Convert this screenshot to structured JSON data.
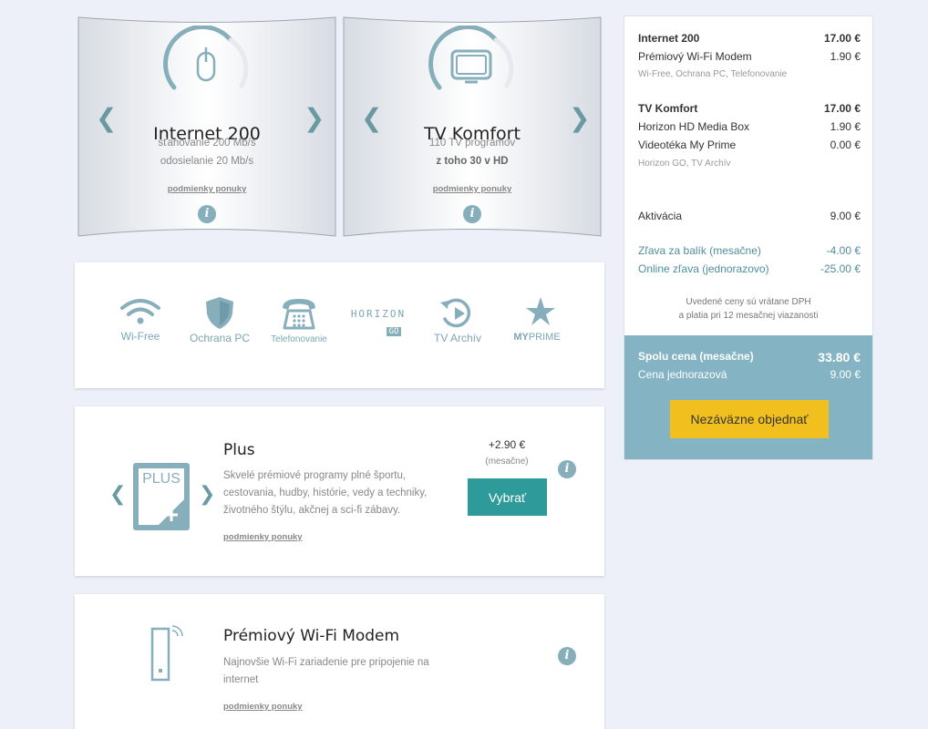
{
  "packages": [
    {
      "title": "Internet 200",
      "line1": "sťahovanie 200 Mb/s",
      "line2": "odosielanie 20 Mb/s",
      "terms": "podmienky ponuky",
      "icon": "mouse-icon"
    },
    {
      "title": "TV Komfort",
      "line1": "110 TV programov",
      "line2": "z toho 30 v HD",
      "terms": "podmienky ponuky",
      "icon": "tv-icon"
    }
  ],
  "glyphs": {
    "prev": "❮",
    "next": "❯",
    "info": "i"
  },
  "features": [
    {
      "label": "Wi-Free",
      "icon": "wifi-icon"
    },
    {
      "label": "Ochrana PC",
      "icon": "shield-icon"
    },
    {
      "label": "Telefonovanie",
      "icon": "phone-icon"
    },
    {
      "label": "HORIZON",
      "label2": "GO",
      "icon": "horizon-go-logo"
    },
    {
      "label": "TV Archív",
      "icon": "tv-archive-icon"
    },
    {
      "label": "MY",
      "label2": "PRIME",
      "icon": "my-prime-logo"
    }
  ],
  "addons": [
    {
      "title": "Plus",
      "badge": "PLUS",
      "description": "Skvelé prémiové programy plné športu, cestovania, hudby, histórie, vedy a techniky, životného štýlu, akčnej a sci-fi zábavy.",
      "terms": "podmienky ponuky",
      "price": "+2.90 €",
      "period": "(mesačne)",
      "button": "Vybrať"
    },
    {
      "title": "Prémiový Wi-Fi Modem",
      "description": "Najnovšie Wi-Fi zariadenie pre pripojenie na internet",
      "terms": "podmienky ponuky"
    }
  ],
  "summary": {
    "internet": {
      "name": "Internet 200",
      "price": "17.00 €"
    },
    "modem": {
      "name": "Prémiový Wi-Fi Modem",
      "price": "1.90 €"
    },
    "internet_extras": "Wi-Free, Ochrana PC, Telefonovanie",
    "tv": {
      "name": "TV Komfort",
      "price": "17.00 €"
    },
    "mediabox": {
      "name": "Horizon HD Media Box",
      "price": "1.90 €"
    },
    "videoteka": {
      "name": "Videotéka My Prime",
      "price": "0.00 €"
    },
    "tv_extras": "Horizon GO, TV Archív",
    "activation": {
      "name": "Aktivácia",
      "price": "9.00 €"
    },
    "discount_bundle": {
      "name": "Zľava za balík (mesačne)",
      "price": "-4.00 €"
    },
    "discount_online": {
      "name": "Online zľava (jednorazovo)",
      "price": "-25.00 €"
    },
    "note1": "Uvedené ceny sú vrátane DPH",
    "note2": "a platia pri 12 mesačnej viazanosti",
    "total_monthly": {
      "name": "Spolu cena (mesačne)",
      "price": "33.80 €"
    },
    "total_once": {
      "name": "Cena jednorazová",
      "price": "9.00 €"
    },
    "order_button": "Nezáväzne objednať"
  },
  "colors": {
    "accent": "#2f9a9a",
    "icon": "#7aa7b3",
    "summary_bg": "#84b3c4",
    "order": "#f2c01e"
  }
}
